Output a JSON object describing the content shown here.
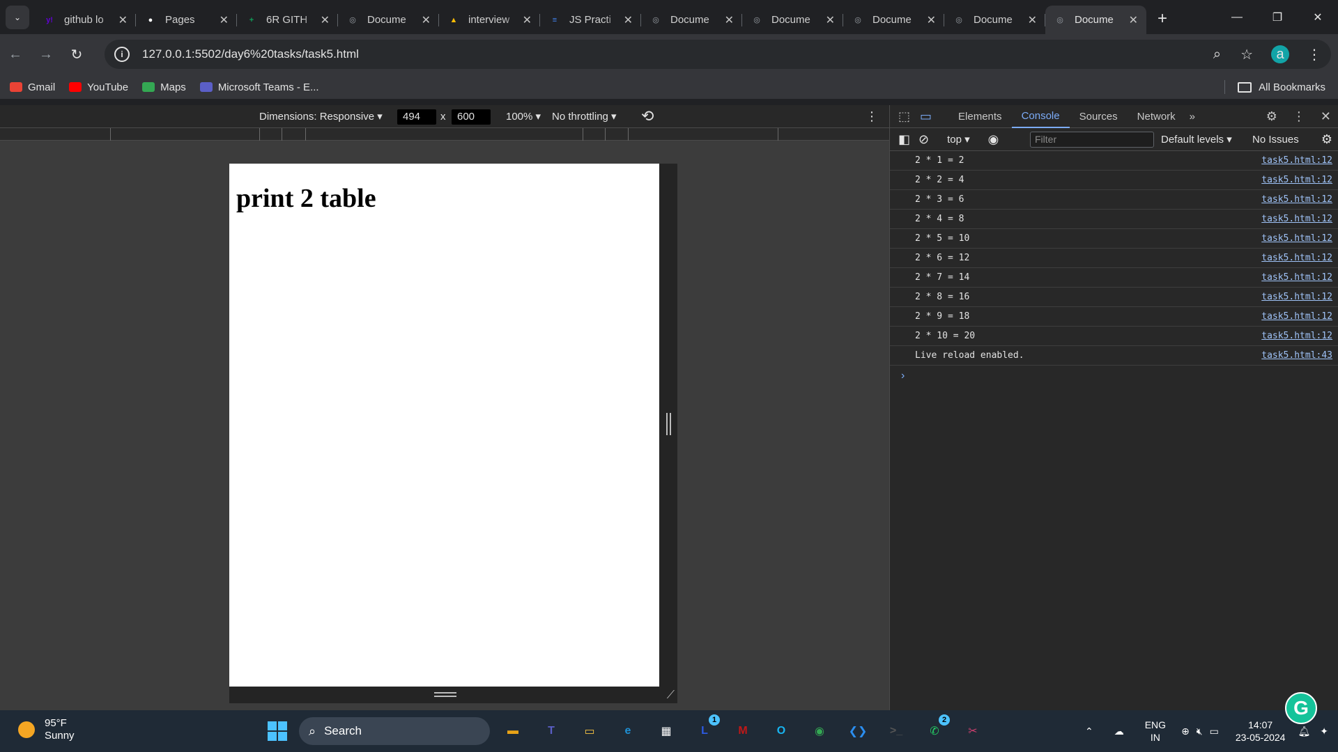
{
  "tabs": [
    {
      "title": "github lo",
      "icon": "yahoo-icon",
      "color": "#6001d2",
      "glyph": "y!"
    },
    {
      "title": "Pages",
      "icon": "github-icon",
      "color": "#ffffff",
      "glyph": "●"
    },
    {
      "title": "6R GITH",
      "icon": "sheets-icon",
      "color": "#0f9d58",
      "glyph": "+"
    },
    {
      "title": "Docume",
      "icon": "globe-icon",
      "color": "#9aa0a6",
      "glyph": "◎"
    },
    {
      "title": "interview",
      "icon": "drive-icon",
      "color": "#fbbc04",
      "glyph": "▲"
    },
    {
      "title": "JS Practi",
      "icon": "docs-icon",
      "color": "#4285f4",
      "glyph": "≡"
    },
    {
      "title": "Docume",
      "icon": "globe-icon",
      "color": "#9aa0a6",
      "glyph": "◎"
    },
    {
      "title": "Docume",
      "icon": "globe-icon",
      "color": "#9aa0a6",
      "glyph": "◎"
    },
    {
      "title": "Docume",
      "icon": "globe-icon",
      "color": "#9aa0a6",
      "glyph": "◎"
    },
    {
      "title": "Docume",
      "icon": "globe-icon",
      "color": "#9aa0a6",
      "glyph": "◎"
    },
    {
      "title": "Docume",
      "icon": "globe-icon",
      "color": "#9aa0a6",
      "glyph": "◎",
      "active": true
    }
  ],
  "address": {
    "url": "127.0.0.1:5502/day6%20tasks/task5.html",
    "avatar": "a"
  },
  "bookmarks": {
    "items": [
      {
        "label": "Gmail",
        "icon": "gmail-icon",
        "color": "#ea4335"
      },
      {
        "label": "YouTube",
        "icon": "youtube-icon",
        "color": "#ff0000"
      },
      {
        "label": "Maps",
        "icon": "maps-icon",
        "color": "#34a853"
      },
      {
        "label": "Microsoft Teams - E...",
        "icon": "teams-icon",
        "color": "#5b5fc7"
      }
    ],
    "all_label": "All Bookmarks"
  },
  "device_toolbar": {
    "dimensions_label": "Dimensions: Responsive",
    "width": "494",
    "height": "600",
    "times": "x",
    "zoom": "100%",
    "throttle": "No throttling"
  },
  "page": {
    "heading": "print 2 table"
  },
  "devtools": {
    "tabs": [
      "Elements",
      "Console",
      "Sources",
      "Network"
    ],
    "active_tab": "Console",
    "context": "top",
    "filter_placeholder": "Filter",
    "levels": "Default levels",
    "issues": "No Issues",
    "logs": [
      {
        "text": "2 * 1 = 2",
        "src": "task5.html:12"
      },
      {
        "text": "2 * 2 = 4",
        "src": "task5.html:12"
      },
      {
        "text": "2 * 3 = 6",
        "src": "task5.html:12"
      },
      {
        "text": "2 * 4 = 8",
        "src": "task5.html:12"
      },
      {
        "text": "2 * 5 = 10",
        "src": "task5.html:12"
      },
      {
        "text": "2 * 6 = 12",
        "src": "task5.html:12"
      },
      {
        "text": "2 * 7 = 14",
        "src": "task5.html:12"
      },
      {
        "text": "2 * 8 = 16",
        "src": "task5.html:12"
      },
      {
        "text": "2 * 9 = 18",
        "src": "task5.html:12"
      },
      {
        "text": "2 * 10 = 20",
        "src": "task5.html:12"
      },
      {
        "text": "Live reload enabled.",
        "src": "task5.html:43"
      }
    ]
  },
  "taskbar": {
    "weather_temp": "95°F",
    "weather_desc": "Sunny",
    "search_label": "Search",
    "apps": [
      {
        "icon": "file-explorer-icon",
        "color": "#e8a317",
        "glyph": "▬"
      },
      {
        "icon": "teams-icon",
        "color": "#5b5fc7",
        "glyph": "T"
      },
      {
        "icon": "folder-icon",
        "color": "#f6c342",
        "glyph": "▭"
      },
      {
        "icon": "edge-icon",
        "color": "#1e90d4",
        "glyph": "e"
      },
      {
        "icon": "store-icon",
        "color": "#ffffff",
        "glyph": "▦"
      },
      {
        "icon": "linkedin-icon",
        "color": "#2d5be3",
        "glyph": "L",
        "badge": "1"
      },
      {
        "icon": "mcafee-icon",
        "color": "#c01818",
        "glyph": "M"
      },
      {
        "icon": "cortana-icon",
        "color": "#18b4f0",
        "glyph": "O"
      },
      {
        "icon": "chrome-icon",
        "color": "#34a853",
        "glyph": "◉"
      },
      {
        "icon": "vscode-icon",
        "color": "#2b8ef0",
        "glyph": "❮❯"
      },
      {
        "icon": "terminal-icon",
        "color": "#555555",
        "glyph": ">_"
      },
      {
        "icon": "whatsapp-icon",
        "color": "#25d366",
        "glyph": "✆",
        "badge": "2"
      },
      {
        "icon": "snipping-tool-icon",
        "color": "#d04070",
        "glyph": "✂"
      }
    ],
    "lang_top": "ENG",
    "lang_bottom": "IN",
    "time": "14:07",
    "date": "23-05-2024"
  }
}
